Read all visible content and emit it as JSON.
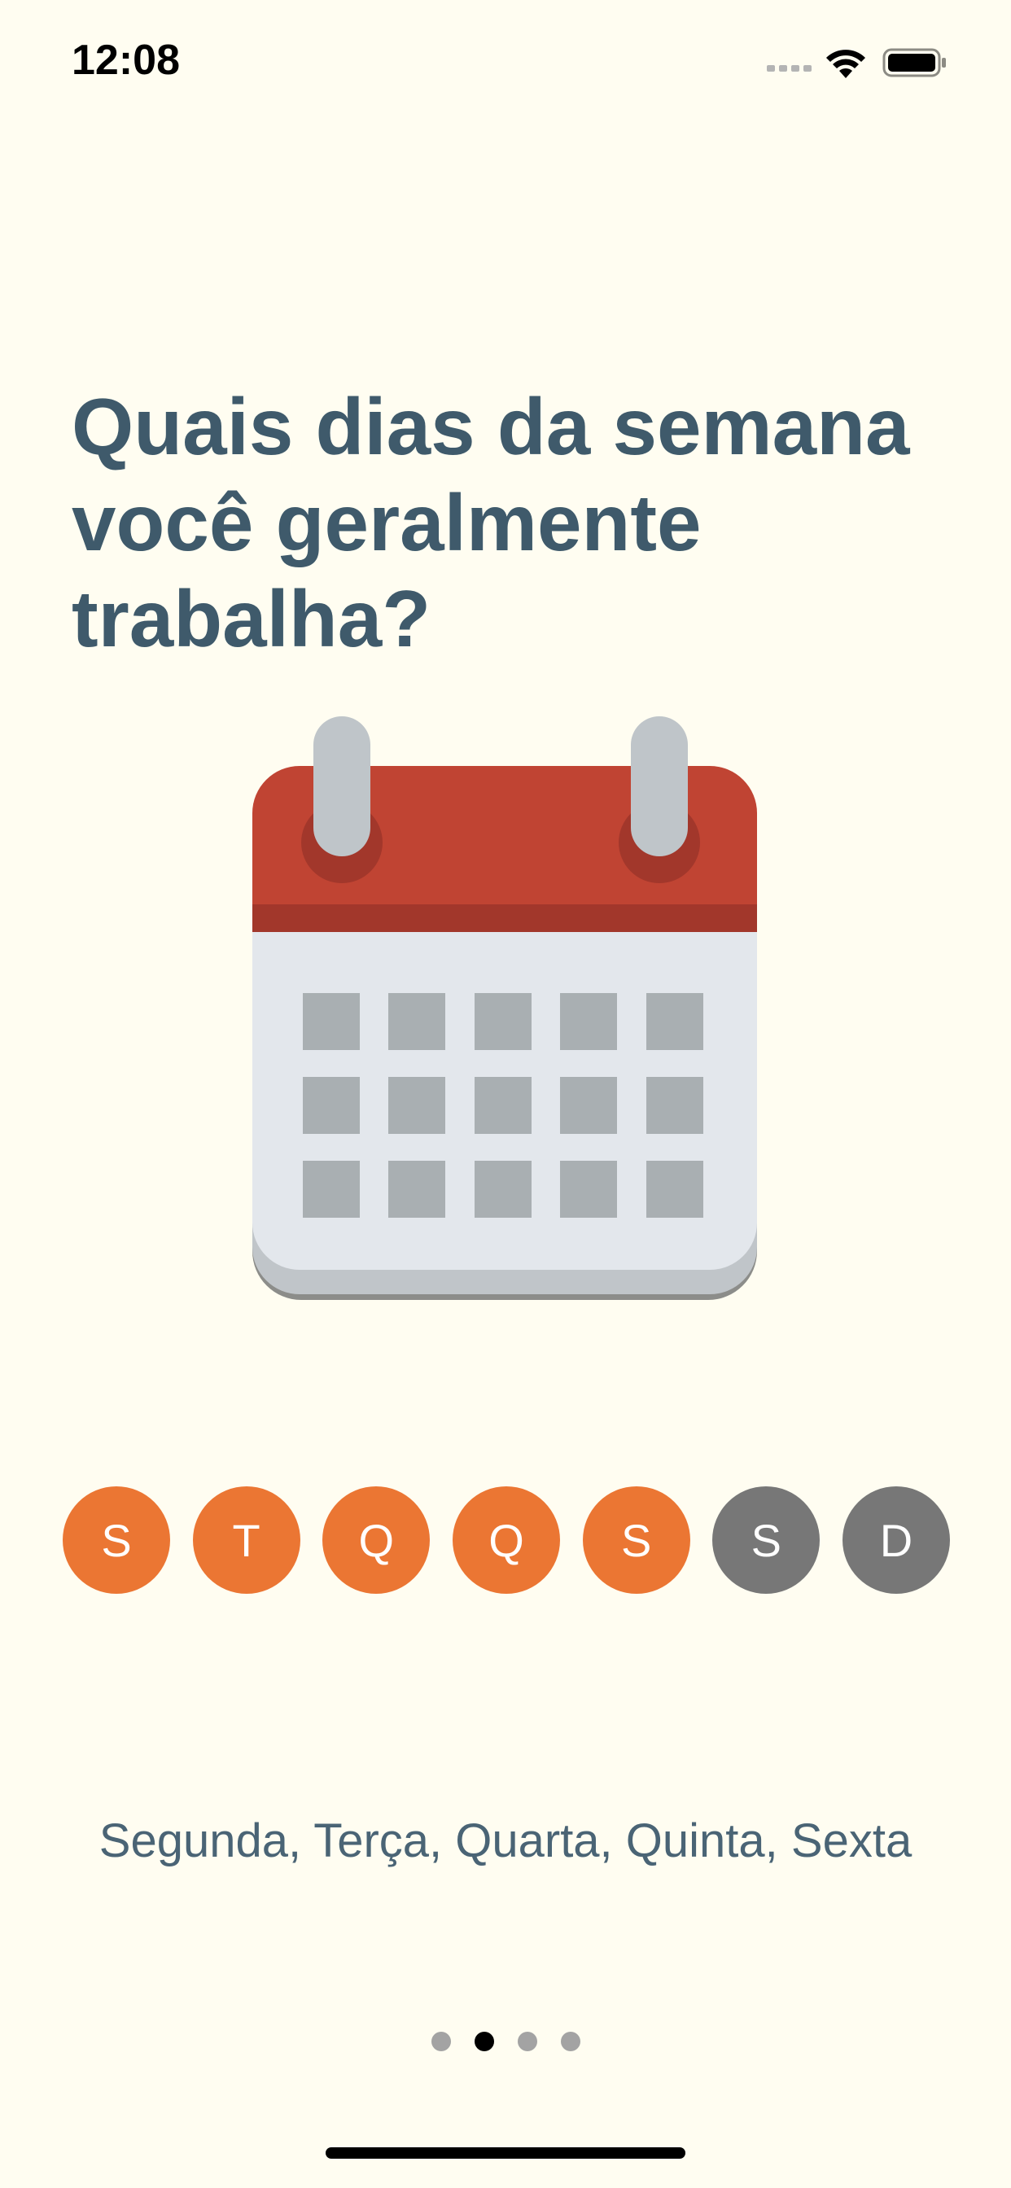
{
  "status_bar": {
    "time": "12:08",
    "icons": [
      "signal-icon",
      "wifi-icon",
      "battery-icon"
    ]
  },
  "title": "Quais dias da semana você geralmente trabalha?",
  "days": [
    {
      "label": "S",
      "selected": true
    },
    {
      "label": "T",
      "selected": true
    },
    {
      "label": "Q",
      "selected": true
    },
    {
      "label": "Q",
      "selected": true
    },
    {
      "label": "S",
      "selected": true
    },
    {
      "label": "S",
      "selected": false
    },
    {
      "label": "D",
      "selected": false
    }
  ],
  "selected_summary": "Segunda, Terça, Quarta, Quinta, Sexta",
  "pagination": {
    "total": 4,
    "current_index": 1
  },
  "colors": {
    "background": "#fffdf1",
    "title": "#3f5a6b",
    "day_selected": "#eb7633",
    "day_unselected": "#777777",
    "summary_text": "#4a6475",
    "dot_active": "#000000",
    "dot_inactive": "#a3a3a3",
    "calendar_red": "#c04433",
    "calendar_red_dark": "#a2372b",
    "calendar_body": "#e3e7ec",
    "calendar_cell": "#a9afb2",
    "calendar_ring": "#bfc5c9"
  }
}
